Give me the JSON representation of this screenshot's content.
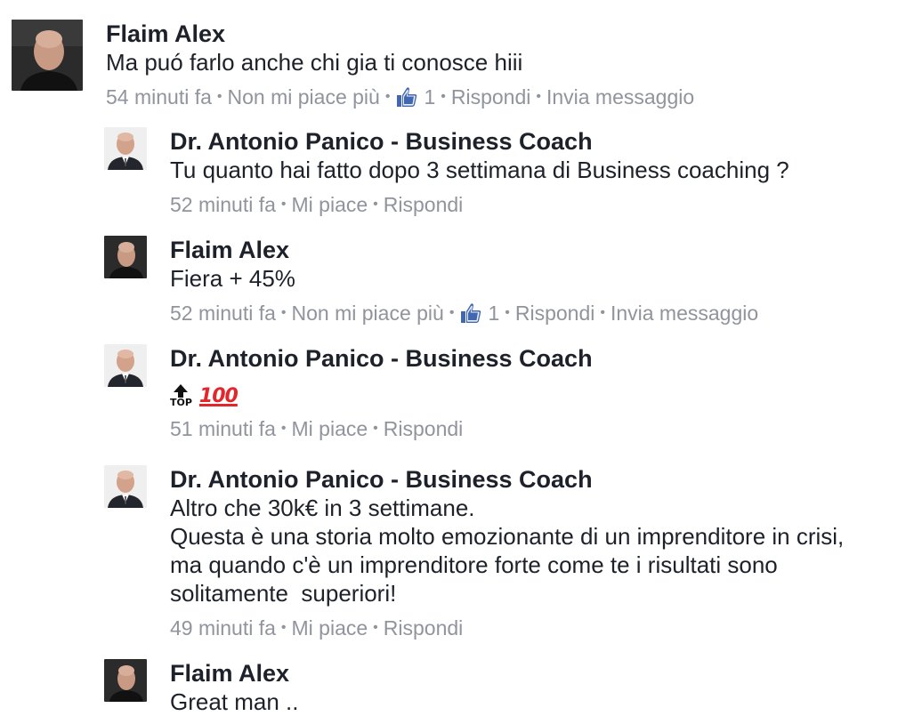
{
  "colors": {
    "text": "#1d2129",
    "meta": "#90949c",
    "like_blue": "#4267b2",
    "hundred_red": "#e3262b"
  },
  "comments": [
    {
      "author": "Flaim Alex",
      "text": "Ma puó farlo anche chi gia ti conosce hiii",
      "time": "54 minuti fa",
      "like_action": "Non mi piace più",
      "like_count": "1",
      "reply": "Rispondi",
      "message": "Invia messaggio",
      "like_icon": "thumbs-up-icon"
    },
    {
      "author": "Dr. Antonio Panico - Business Coach",
      "text": "Tu quanto hai fatto dopo 3 settimana di Business coaching ?",
      "time": "52 minuti fa",
      "like_action": "Mi piace",
      "reply": "Rispondi"
    },
    {
      "author": "Flaim Alex",
      "text": "Fiera + 45%",
      "time": "52 minuti fa",
      "like_action": "Non mi piace più",
      "like_count": "1",
      "reply": "Rispondi",
      "message": "Invia messaggio",
      "like_icon": "thumbs-up-icon"
    },
    {
      "author": "Dr. Antonio Panico - Business Coach",
      "emoji_top_label": "TOP",
      "emoji_hundred": "100",
      "emojis": [
        "top-arrow-emoji",
        "hundred-points-emoji"
      ],
      "time": "51 minuti fa",
      "like_action": "Mi piace",
      "reply": "Rispondi"
    },
    {
      "author": "Dr. Antonio Panico - Business Coach",
      "text": "Altro che 30k€ in 3 settimane.\nQuesta è una storia molto emozionante di un imprenditore in crisi, ma quando c'è un imprenditore forte come te i risultati sono solitamente  superiori!",
      "time": "49 minuti fa",
      "like_action": "Mi piace",
      "reply": "Rispondi"
    },
    {
      "author": "Flaim Alex",
      "text": "Great man .."
    }
  ]
}
